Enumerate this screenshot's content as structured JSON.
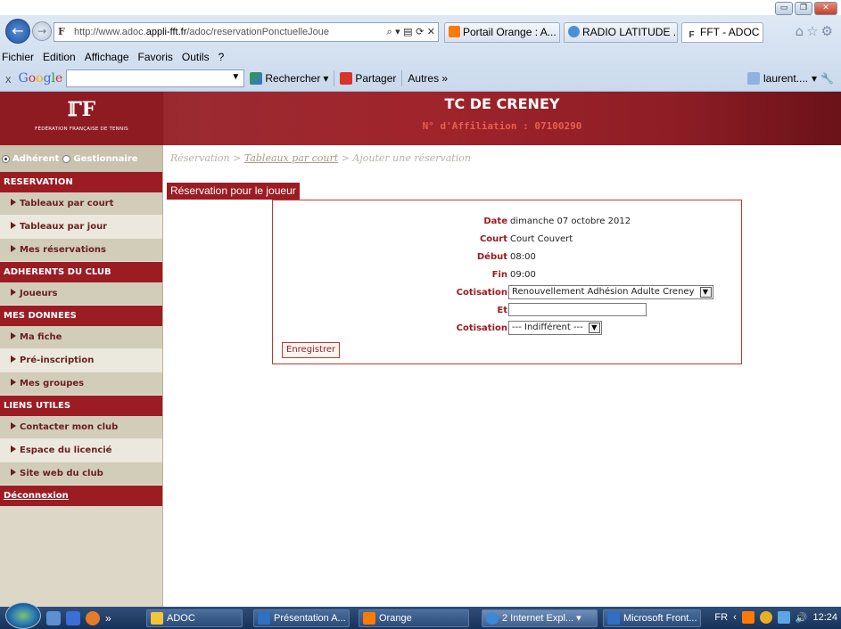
{
  "window": {
    "min_label": "▭",
    "max_label": "❐",
    "close_label": "✕"
  },
  "addressbar": {
    "url_prefix": "http://www.adoc.",
    "url_domain": "appli-fft.fr",
    "url_rest": "/adoc/reservationPonctuelleJoue",
    "icons": "⌕ ▾ ▤ ⟳ ✕"
  },
  "tabs": [
    {
      "label": "Portail Orange : A...",
      "icon_color": "#ff7a00"
    },
    {
      "label": "RADIO LATITUDE ...",
      "icon_color": "#4a90d9"
    },
    {
      "label": "FFT - ADOC - E...",
      "icon_color": "#ffffff"
    }
  ],
  "menu": [
    "Fichier",
    "Edition",
    "Affichage",
    "Favoris",
    "Outils",
    "?"
  ],
  "googlebar": {
    "close": "x",
    "logo": "Google",
    "search_value": "",
    "search_btn": "Rechercher",
    "share_btn": "Partager",
    "others": "Autres »",
    "user": "laurent...."
  },
  "banner": {
    "logo_glyph": "FFT",
    "logo_text": "Fédération Française de Tennis",
    "club_name": "TC DE CRENEY",
    "affiliation": "N° d'Affiliation : 07100290"
  },
  "sidebar": {
    "roles": [
      "Adhérent",
      "Gestionnaire"
    ],
    "sections": [
      {
        "title": "RESERVATION",
        "items": [
          "Tableaux par court",
          "Tableaux par jour",
          "Mes réservations"
        ]
      },
      {
        "title": "ADHERENTS DU CLUB",
        "items": [
          "Joueurs"
        ]
      },
      {
        "title": "MES DONNEES",
        "items": [
          "Ma fiche",
          "Pré-inscription",
          "Mes groupes"
        ]
      },
      {
        "title": "LIENS UTILES",
        "items": [
          "Contacter mon club",
          "Espace du licencié",
          "Site web du club"
        ]
      }
    ],
    "logout": "Déconnexion"
  },
  "main": {
    "breadcrumb": {
      "part1": "Réservation > ",
      "link": "Tableaux par court",
      "part2": " > Ajouter une réservation"
    },
    "panel_title": "Réservation pour le joueur",
    "form": {
      "date_label": "Date",
      "date_value": "dimanche 07 octobre 2012",
      "court_label": "Court",
      "court_value": "Court Couvert",
      "debut_label": "Début",
      "debut_value": "08:00",
      "fin_label": "Fin",
      "fin_value": "09:00",
      "cotisation1_label": "Cotisation",
      "cotisation1_value": "Renouvellement Adhésion Adulte Creney",
      "et_label": "Et",
      "et_value": "",
      "cotisation2_label": "Cotisation",
      "cotisation2_value": "--- Indifférent ---",
      "save_label": "Enregistrer"
    }
  },
  "taskbar": {
    "items": [
      {
        "label": "ADOC",
        "icon_color": "#f3c53a"
      },
      {
        "label": "Présentation A...",
        "icon_color": "#2f6fc4"
      },
      {
        "label": "Orange",
        "icon_color": "#ff7a00"
      },
      {
        "label": "2 Internet Expl...",
        "icon_color": "#3b8ad8"
      },
      {
        "label": "Microsoft Front...",
        "icon_color": "#2f6fc4"
      }
    ],
    "lang": "FR",
    "time": "12:24"
  }
}
